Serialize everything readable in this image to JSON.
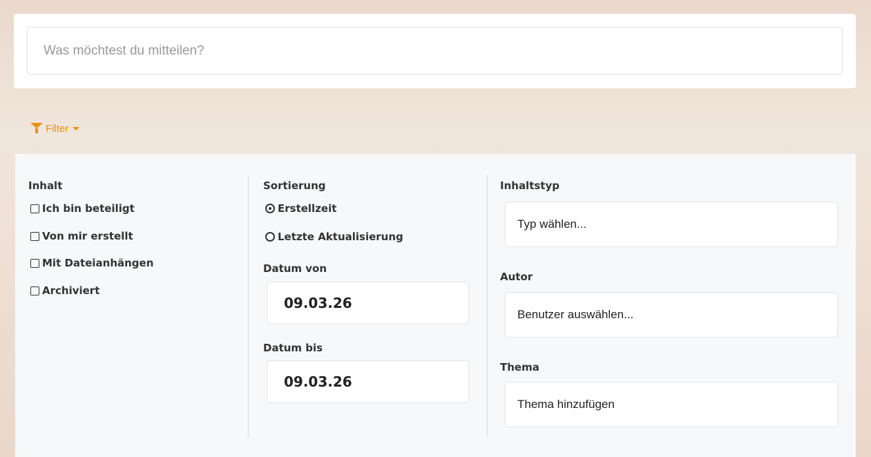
{
  "post": {
    "placeholder": "Was möchtest du mitteilen?"
  },
  "filter": {
    "toggle_label": "Filter"
  },
  "content": {
    "heading": "Inhalt",
    "options": [
      "Ich bin beteiligt",
      "Von mir erstellt",
      "Mit Dateianhängen",
      "Archiviert"
    ]
  },
  "sorting": {
    "heading": "Sortierung",
    "options": [
      {
        "label": "Erstellzeit",
        "selected": true
      },
      {
        "label": "Letzte Aktualisierung",
        "selected": false
      }
    ],
    "date_from_label": "Datum von",
    "date_from_value": "09.03.26",
    "date_to_label": "Datum bis",
    "date_to_value": "09.03.26"
  },
  "content_type": {
    "heading": "Inhaltstyp",
    "placeholder": "Typ wählen..."
  },
  "author": {
    "heading": "Autor",
    "placeholder": "Benutzer auswählen..."
  },
  "topic": {
    "heading": "Thema",
    "placeholder": "Thema hinzufügen"
  },
  "colors": {
    "accent": "#e8900c",
    "panel_bg": "#f7f8f9"
  }
}
